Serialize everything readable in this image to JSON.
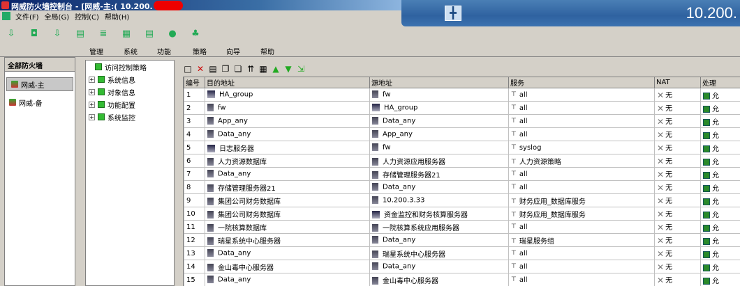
{
  "titlebar": {
    "text": "网威防火墙控制台 - [网威-主:( 10.200."
  },
  "remote_bar": {
    "ip": "10.200.",
    "pin_glyph": "╋"
  },
  "menu": [
    "文件(F)",
    "全局(G)",
    "控制(C)",
    "帮助(H)"
  ],
  "functions": [
    "管理",
    "系统",
    "功能",
    "策略",
    "向导",
    "帮助"
  ],
  "left_panel": {
    "title": "全部防火墙",
    "items": [
      "网威-主",
      "网威-备"
    ]
  },
  "tree": {
    "root": "访问控制策略",
    "nodes": [
      "系统信息",
      "对象信息",
      "功能配置",
      "系统监控"
    ]
  },
  "grid": {
    "headers": [
      "编号",
      "目的地址",
      "源地址",
      "服务",
      "NAT",
      "处理"
    ],
    "rows": [
      {
        "no": "1",
        "dst": "HA_group",
        "dst_icon": "group",
        "src": "fw",
        "src_icon": "host",
        "svc": "all",
        "nat": "无",
        "act": "允"
      },
      {
        "no": "2",
        "dst": "fw",
        "dst_icon": "host",
        "src": "HA_group",
        "src_icon": "group",
        "svc": "all",
        "nat": "无",
        "act": "允"
      },
      {
        "no": "3",
        "dst": "App_any",
        "dst_icon": "host",
        "src": "Data_any",
        "src_icon": "host",
        "svc": "all",
        "nat": "无",
        "act": "允"
      },
      {
        "no": "4",
        "dst": "Data_any",
        "dst_icon": "host",
        "src": "App_any",
        "src_icon": "host",
        "svc": "all",
        "nat": "无",
        "act": "允"
      },
      {
        "no": "5",
        "dst": "日志服务器",
        "dst_icon": "group",
        "src": "fw",
        "src_icon": "host",
        "svc": "syslog",
        "nat": "无",
        "act": "允"
      },
      {
        "no": "6",
        "dst": "人力资源数据库",
        "dst_icon": "host",
        "src": "人力资源应用服务器",
        "src_icon": "host",
        "svc": "人力资源策略",
        "nat": "无",
        "act": "允"
      },
      {
        "no": "7",
        "dst": "Data_any",
        "dst_icon": "host",
        "src": "存储管理服务器21",
        "src_icon": "host",
        "svc": "all",
        "nat": "无",
        "act": "允"
      },
      {
        "no": "8",
        "dst": "存储管理服务器21",
        "dst_icon": "host",
        "src": "Data_any",
        "src_icon": "host",
        "svc": "all",
        "nat": "无",
        "act": "允"
      },
      {
        "no": "9",
        "dst": "集团公司财务数据库",
        "dst_icon": "host",
        "src": "10.200.3.33",
        "src_icon": "host",
        "svc": "财务应用_数据库服务",
        "nat": "无",
        "act": "允"
      },
      {
        "no": "10",
        "dst": "集团公司财务数据库",
        "dst_icon": "host",
        "src": "资金监控和财务核算服务器",
        "src_icon": "group",
        "svc": "财务应用_数据库服务",
        "nat": "无",
        "act": "允"
      },
      {
        "no": "11",
        "dst": "一院核算数据库",
        "dst_icon": "host",
        "src": "一院核算系统应用服务器",
        "src_icon": "host",
        "svc": "all",
        "nat": "无",
        "act": "允"
      },
      {
        "no": "12",
        "dst": "瑞星系统中心服务器",
        "dst_icon": "host",
        "src": "Data_any",
        "src_icon": "host",
        "svc": "瑞星服务组",
        "nat": "无",
        "act": "允"
      },
      {
        "no": "13",
        "dst": "Data_any",
        "dst_icon": "host",
        "src": "瑞星系统中心服务器",
        "src_icon": "host",
        "svc": "all",
        "nat": "无",
        "act": "允"
      },
      {
        "no": "14",
        "dst": "金山毒中心服务器",
        "dst_icon": "host",
        "src": "Data_any",
        "src_icon": "host",
        "svc": "all",
        "nat": "无",
        "act": "允"
      },
      {
        "no": "15",
        "dst": "Data_any",
        "dst_icon": "host",
        "src": "金山毒中心服务器",
        "src_icon": "host",
        "svc": "all",
        "nat": "无",
        "act": "允"
      }
    ]
  }
}
